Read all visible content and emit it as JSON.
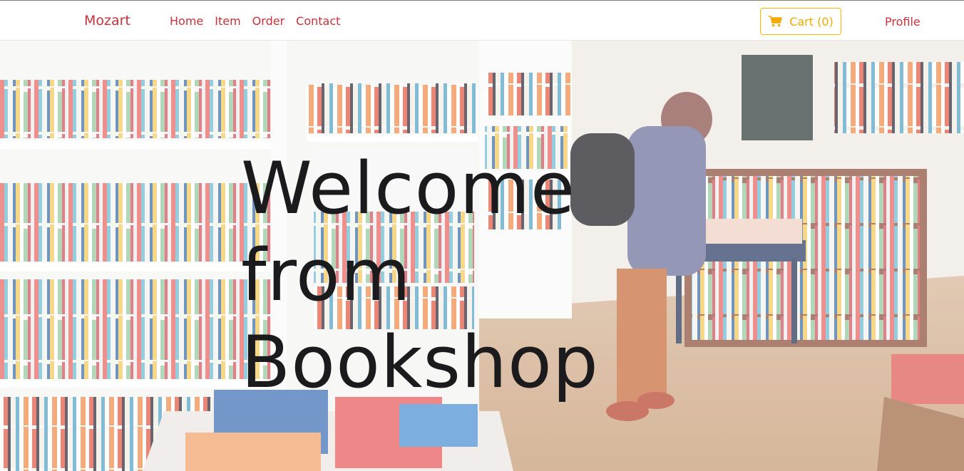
{
  "navbar": {
    "brand": "Mozart",
    "links": [
      {
        "label": "Home"
      },
      {
        "label": "Item"
      },
      {
        "label": "Order"
      },
      {
        "label": "Contact"
      }
    ],
    "cart": {
      "label": "Cart (0)",
      "icon": "shopping-cart-icon"
    },
    "profile": "Profile"
  },
  "hero": {
    "title_lines": [
      "Welcome",
      "from",
      "Bookshop"
    ],
    "background": "bookshop-interior-photo"
  },
  "colors": {
    "brand_red": "#c8323b",
    "cart_yellow": "#f2a900",
    "title_dark": "#1b1b1d"
  }
}
